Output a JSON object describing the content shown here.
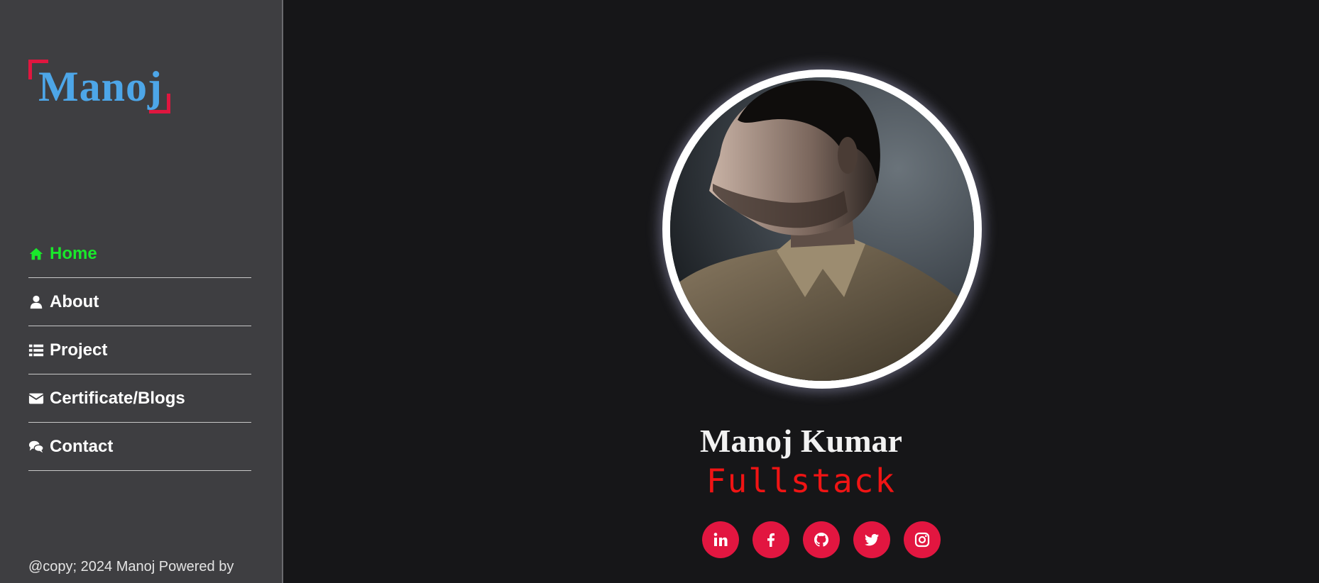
{
  "brand": {
    "logo_text": "Manoj",
    "logo_color": "#4da6e8",
    "accent_color": "#e0163f"
  },
  "sidebar": {
    "items": [
      {
        "label": "Home",
        "icon": "home-icon",
        "active": true
      },
      {
        "label": "About",
        "icon": "user-icon",
        "active": false
      },
      {
        "label": "Project",
        "icon": "list-icon",
        "active": false
      },
      {
        "label": "Certificate/Blogs",
        "icon": "envelope-icon",
        "active": false
      },
      {
        "label": "Contact",
        "icon": "chat-bubbles-icon",
        "active": false
      }
    ],
    "active_color": "#19e82b",
    "footer": "@copy; 2024 Manoj Powered by"
  },
  "profile": {
    "name": "Manoj Kumar",
    "role": "Fullstack",
    "role_color": "#f01414",
    "photo": "profile-photo"
  },
  "socials": {
    "button_color": "#e21640",
    "items": [
      {
        "icon": "linkedin-icon"
      },
      {
        "icon": "facebook-icon"
      },
      {
        "icon": "github-icon"
      },
      {
        "icon": "twitter-icon"
      },
      {
        "icon": "instagram-icon"
      }
    ]
  }
}
